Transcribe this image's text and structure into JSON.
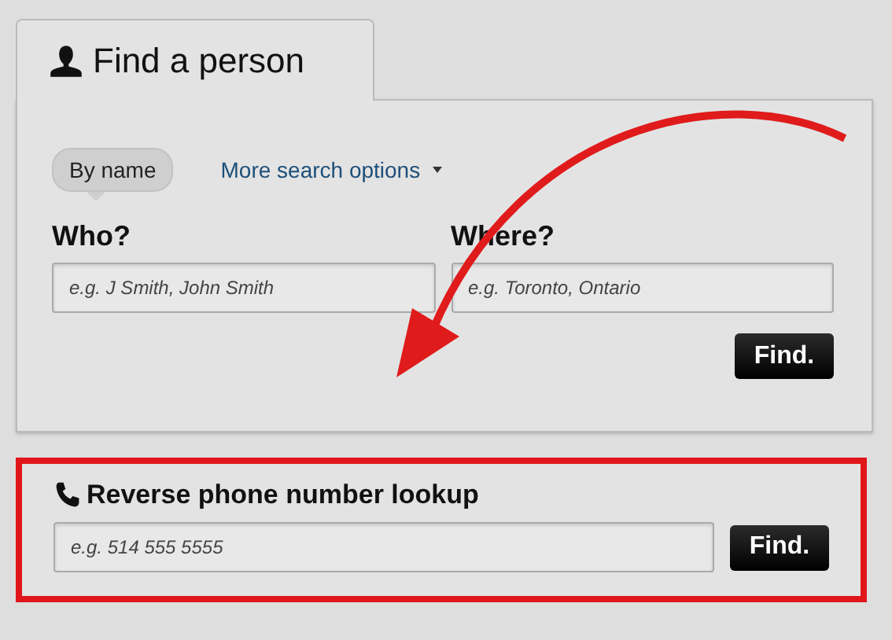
{
  "tab": {
    "label": "Find a person",
    "selected": true
  },
  "search_modes": [
    {
      "label": "By name",
      "selected": true
    }
  ],
  "more_options": {
    "label": "More search options"
  },
  "fields": [
    {
      "label": "Who?",
      "placeholder": "e.g. J Smith, John Smith"
    },
    {
      "label": "Where?",
      "placeholder": "e.g. Toronto, Ontario"
    }
  ],
  "find_button": "Find.",
  "reverse_lookup": {
    "title": "Reverse phone number lookup",
    "placeholder": "e.g. 514 555 5555",
    "button": "Find.",
    "highlighted": true
  }
}
